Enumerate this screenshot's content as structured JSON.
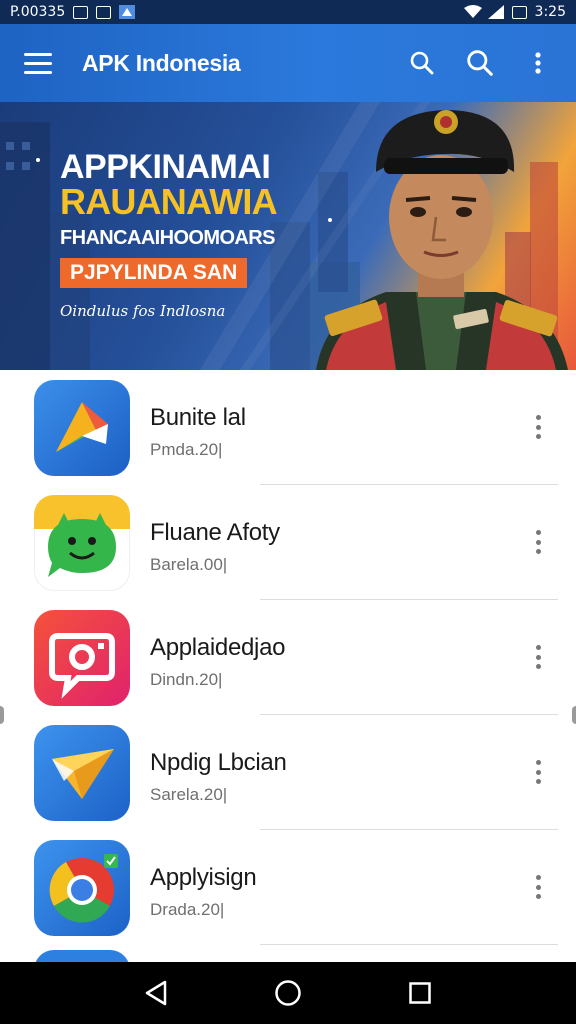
{
  "status_bar": {
    "left_text": "P.00335",
    "right_text": "3:25"
  },
  "app_bar": {
    "title": "APK Indonesia",
    "menu_icon": "hamburger-icon",
    "actions": [
      "search-icon",
      "search-icon",
      "more-vert-icon"
    ]
  },
  "banner": {
    "line1": "APPKINAMAI",
    "line2": "RAUANAWIA",
    "line3": "FHANCAAIHOOMOARS",
    "badge": "PJPYLINDA SAN",
    "tagline": "Oindulus fos Indlosna"
  },
  "apps": [
    {
      "name": "Bunite lal",
      "subtitle": "Pmda.20|",
      "icon": "paper-plane-icon"
    },
    {
      "name": "Fluane Afoty",
      "subtitle": "Barela.00|",
      "icon": "chat-face-icon"
    },
    {
      "name": "Applaidedjao",
      "subtitle": "Dindn.20|",
      "icon": "camera-chat-icon"
    },
    {
      "name": "Npdig Lbcian",
      "subtitle": "Sarela.20|",
      "icon": "send-icon"
    },
    {
      "name": "Applyisign",
      "subtitle": "Drada.20|",
      "icon": "chrome-icon"
    }
  ],
  "colors": {
    "app_bar": "#2b79dc",
    "status_bar": "#0e2a55",
    "banner_yellow": "#f6c125",
    "banner_orange": "#ef6a2a"
  }
}
